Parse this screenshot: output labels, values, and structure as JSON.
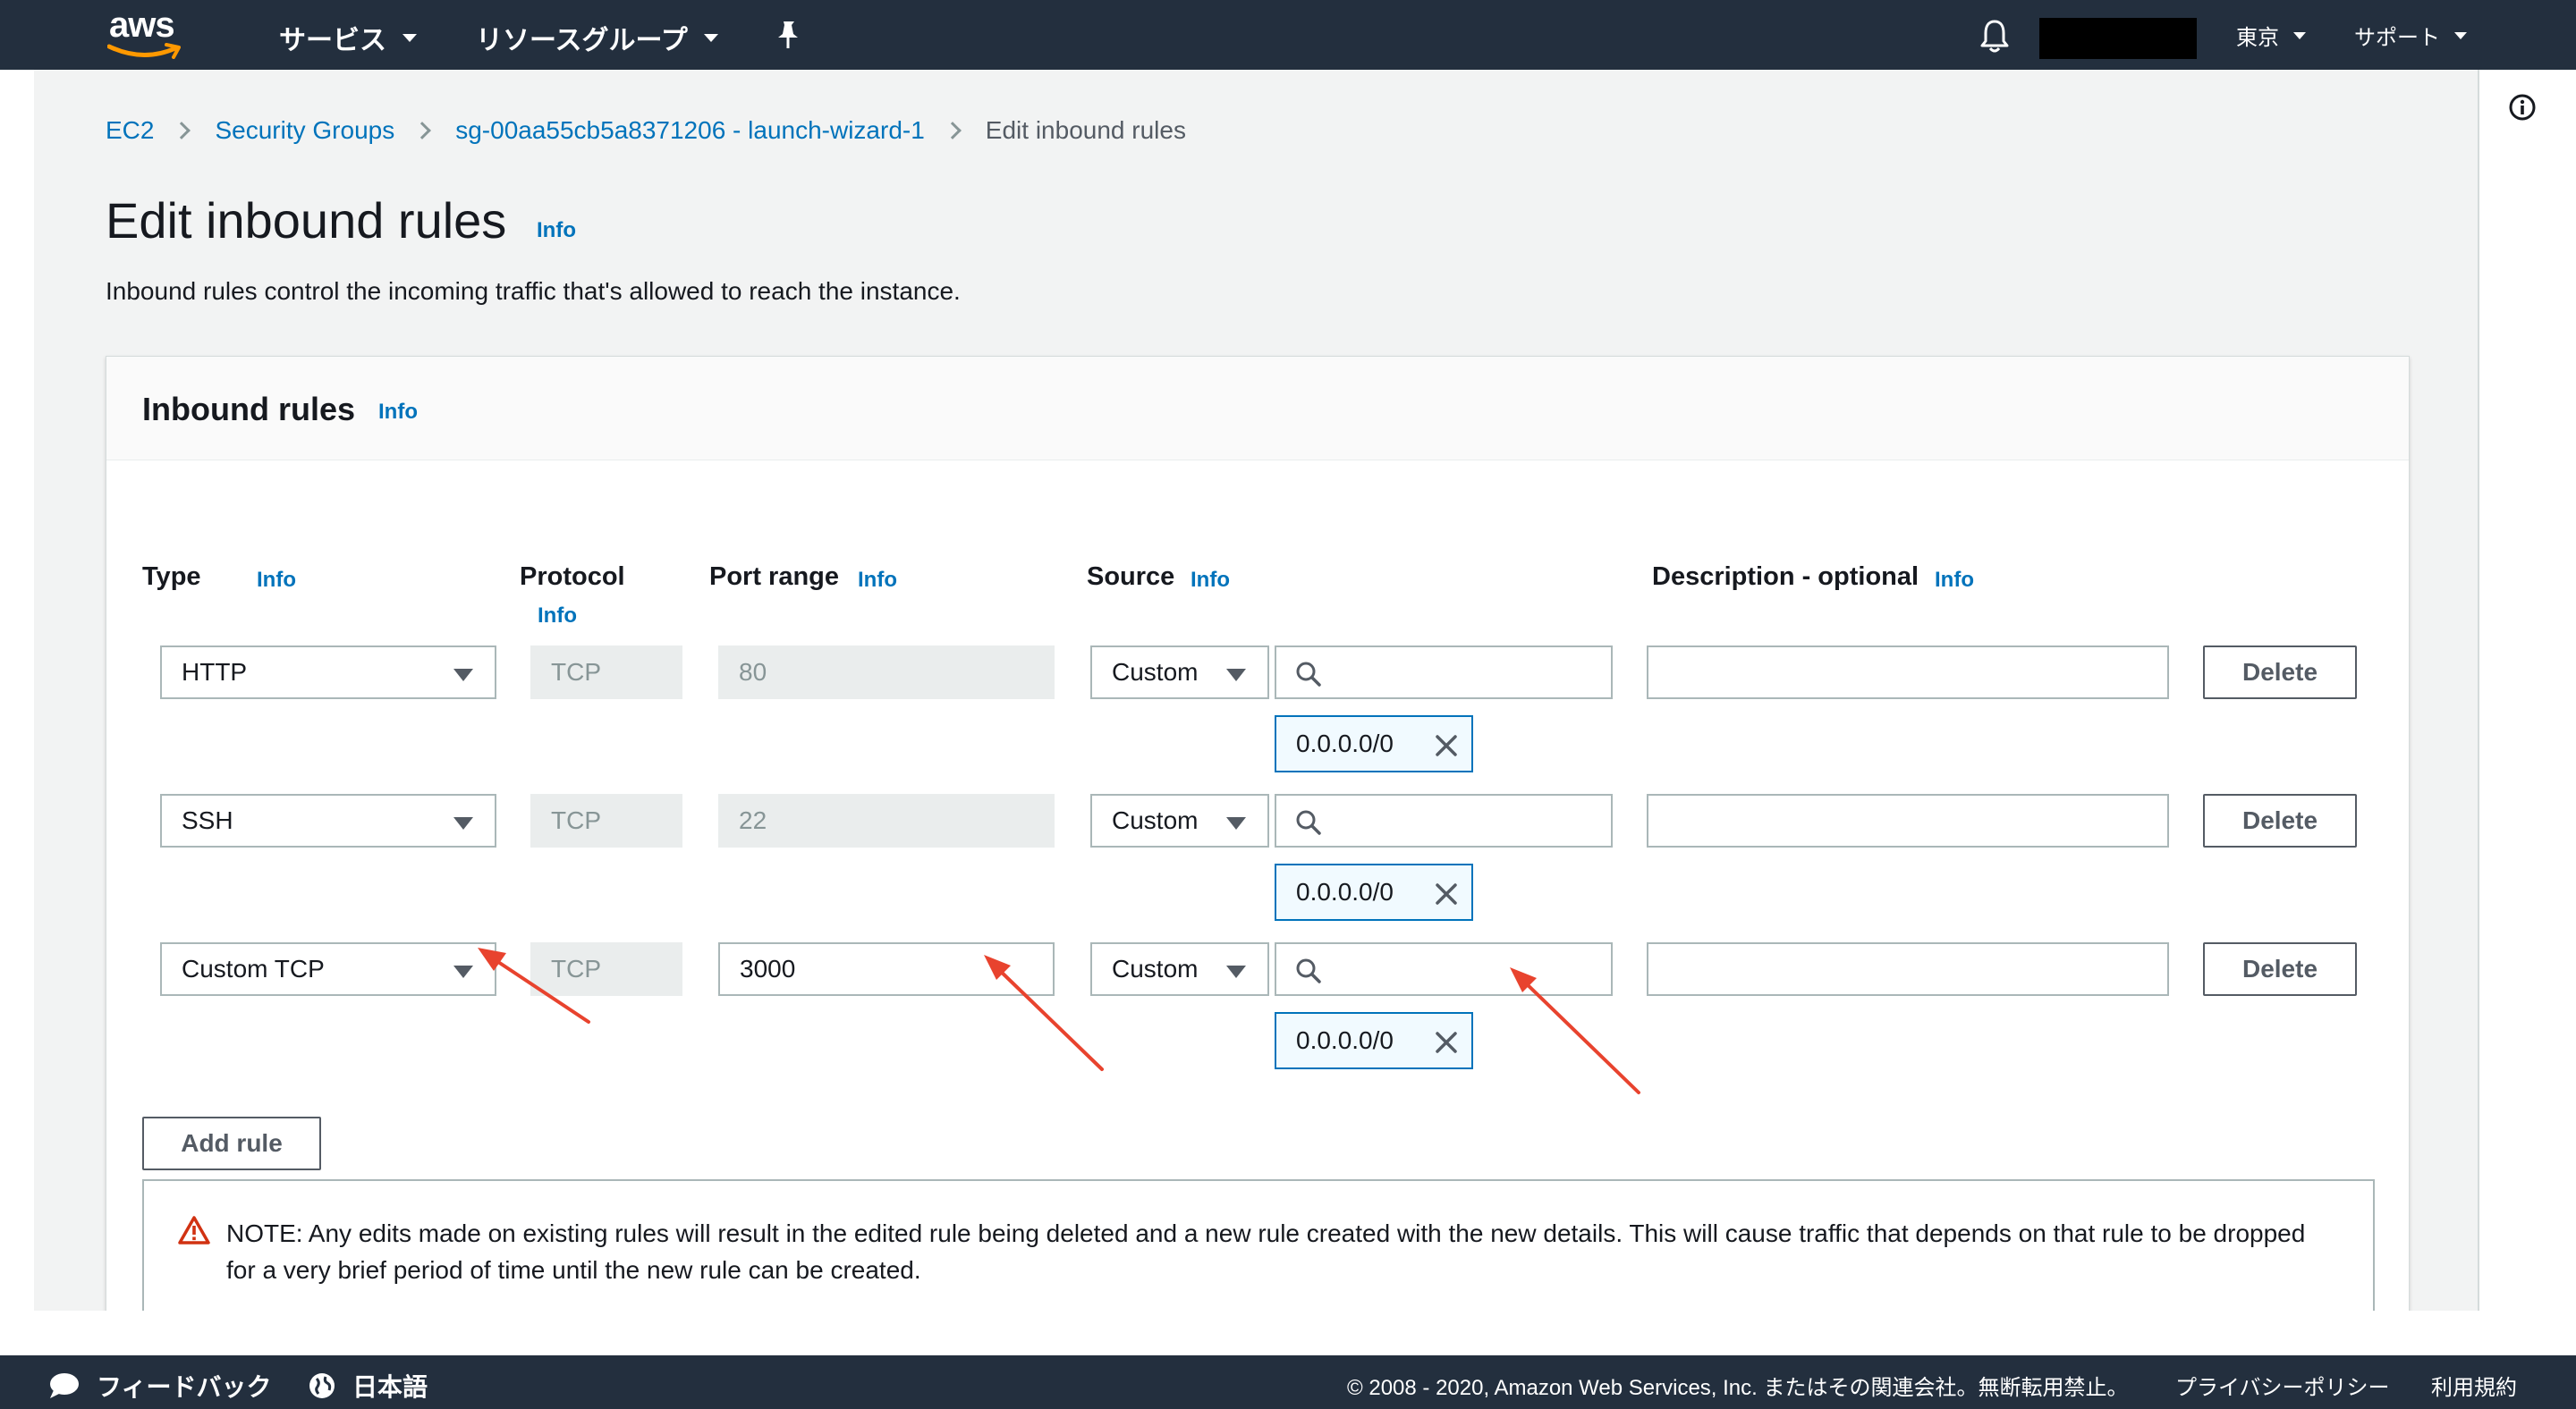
{
  "topnav": {
    "logo_text": "aws",
    "services_label": "サービス",
    "resource_groups_label": "リソースグループ",
    "region_label": "東京",
    "support_label": "サポート"
  },
  "breadcrumb": {
    "items": [
      "EC2",
      "Security Groups",
      "sg-00aa55cb5a8371206 - launch-wizard-1",
      "Edit inbound rules"
    ]
  },
  "page": {
    "title": "Edit inbound rules",
    "title_info": "Info",
    "description": "Inbound rules control the incoming traffic that's allowed to reach the instance."
  },
  "panel": {
    "title": "Inbound rules",
    "title_info": "Info",
    "columns": {
      "type": "Type",
      "protocol": "Protocol",
      "port_range": "Port range",
      "source": "Source",
      "description": "Description - optional",
      "info": "Info"
    },
    "rules": [
      {
        "type": "HTTP",
        "protocol": "TCP",
        "port": "80",
        "source_type": "Custom",
        "source_search": "",
        "cidr": "0.0.0.0/0",
        "description": "",
        "delete_label": "Delete"
      },
      {
        "type": "SSH",
        "protocol": "TCP",
        "port": "22",
        "source_type": "Custom",
        "source_search": "",
        "cidr": "0.0.0.0/0",
        "description": "",
        "delete_label": "Delete"
      },
      {
        "type": "Custom TCP",
        "protocol": "TCP",
        "port": "3000",
        "source_type": "Custom",
        "source_search": "",
        "cidr": "0.0.0.0/0",
        "description": "",
        "delete_label": "Delete"
      }
    ],
    "add_rule_label": "Add rule",
    "note": "NOTE: Any edits made on existing rules will result in the edited rule being deleted and a new rule created with the new details. This will cause traffic that depends on that rule to be dropped for a very brief period of time until the new rule can be created."
  },
  "annotation_color": "#e8432e",
  "footer": {
    "feedback_label": "フィードバック",
    "language_label": "日本語",
    "copyright": "© 2008 - 2020, Amazon Web Services, Inc. またはその関連会社。無断転用禁止。",
    "privacy_label": "プライバシーポリシー",
    "terms_label": "利用規約"
  }
}
